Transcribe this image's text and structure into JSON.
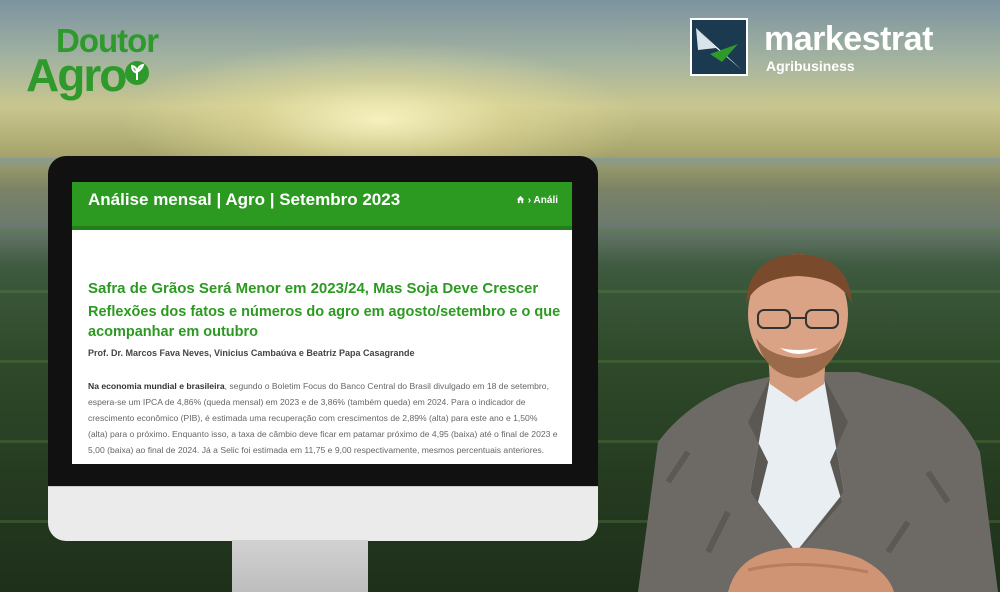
{
  "logos": {
    "doutor_agro_line1": "Doutor",
    "doutor_agro_line2": "Agro",
    "markestrat_name": "markestrat",
    "markestrat_sub": "Agribusiness"
  },
  "screen": {
    "header_title": "Análise mensal | Agro | Setembro 2023",
    "breadcrumb_sep": "›",
    "breadcrumb_label": "Análi",
    "article_title": "Safra de Grãos Será Menor em 2023/24, Mas Soja Deve Crescer",
    "article_subtitle": "Reflexões dos fatos e números do agro em agosto/setembro e o que acompanhar em outubro",
    "authors": "Prof. Dr. Marcos Fava Neves, Vinicius Cambaúva e Beatriz Papa Casagrande",
    "body_lead": "Na economia mundial e brasileira",
    "body_rest": ", segundo o Boletim Focus do Banco Central do Brasil divulgado em 18 de setembro, espera-se um IPCA de 4,86% (queda mensal) em 2023 e de 3,86% (também queda) em 2024. Para o indicador de crescimento econômico (PIB), é estimada uma recuperação com crescimentos de 2,89% (alta) para este ano e 1,50% (alta) para o próximo. Enquanto isso, a taxa de câmbio deve ficar em patamar próximo de 4,95 (baixa) até o final de 2023 e 5,00 (baixa) ao final de 2024. Já a Selic foi estimada em 11,75 e 9,00 respectivamente, mesmos percentuais anteriores."
  },
  "colors": {
    "brand_green": "#2c9a21",
    "markestrat_blue": "#1c3a4f"
  }
}
